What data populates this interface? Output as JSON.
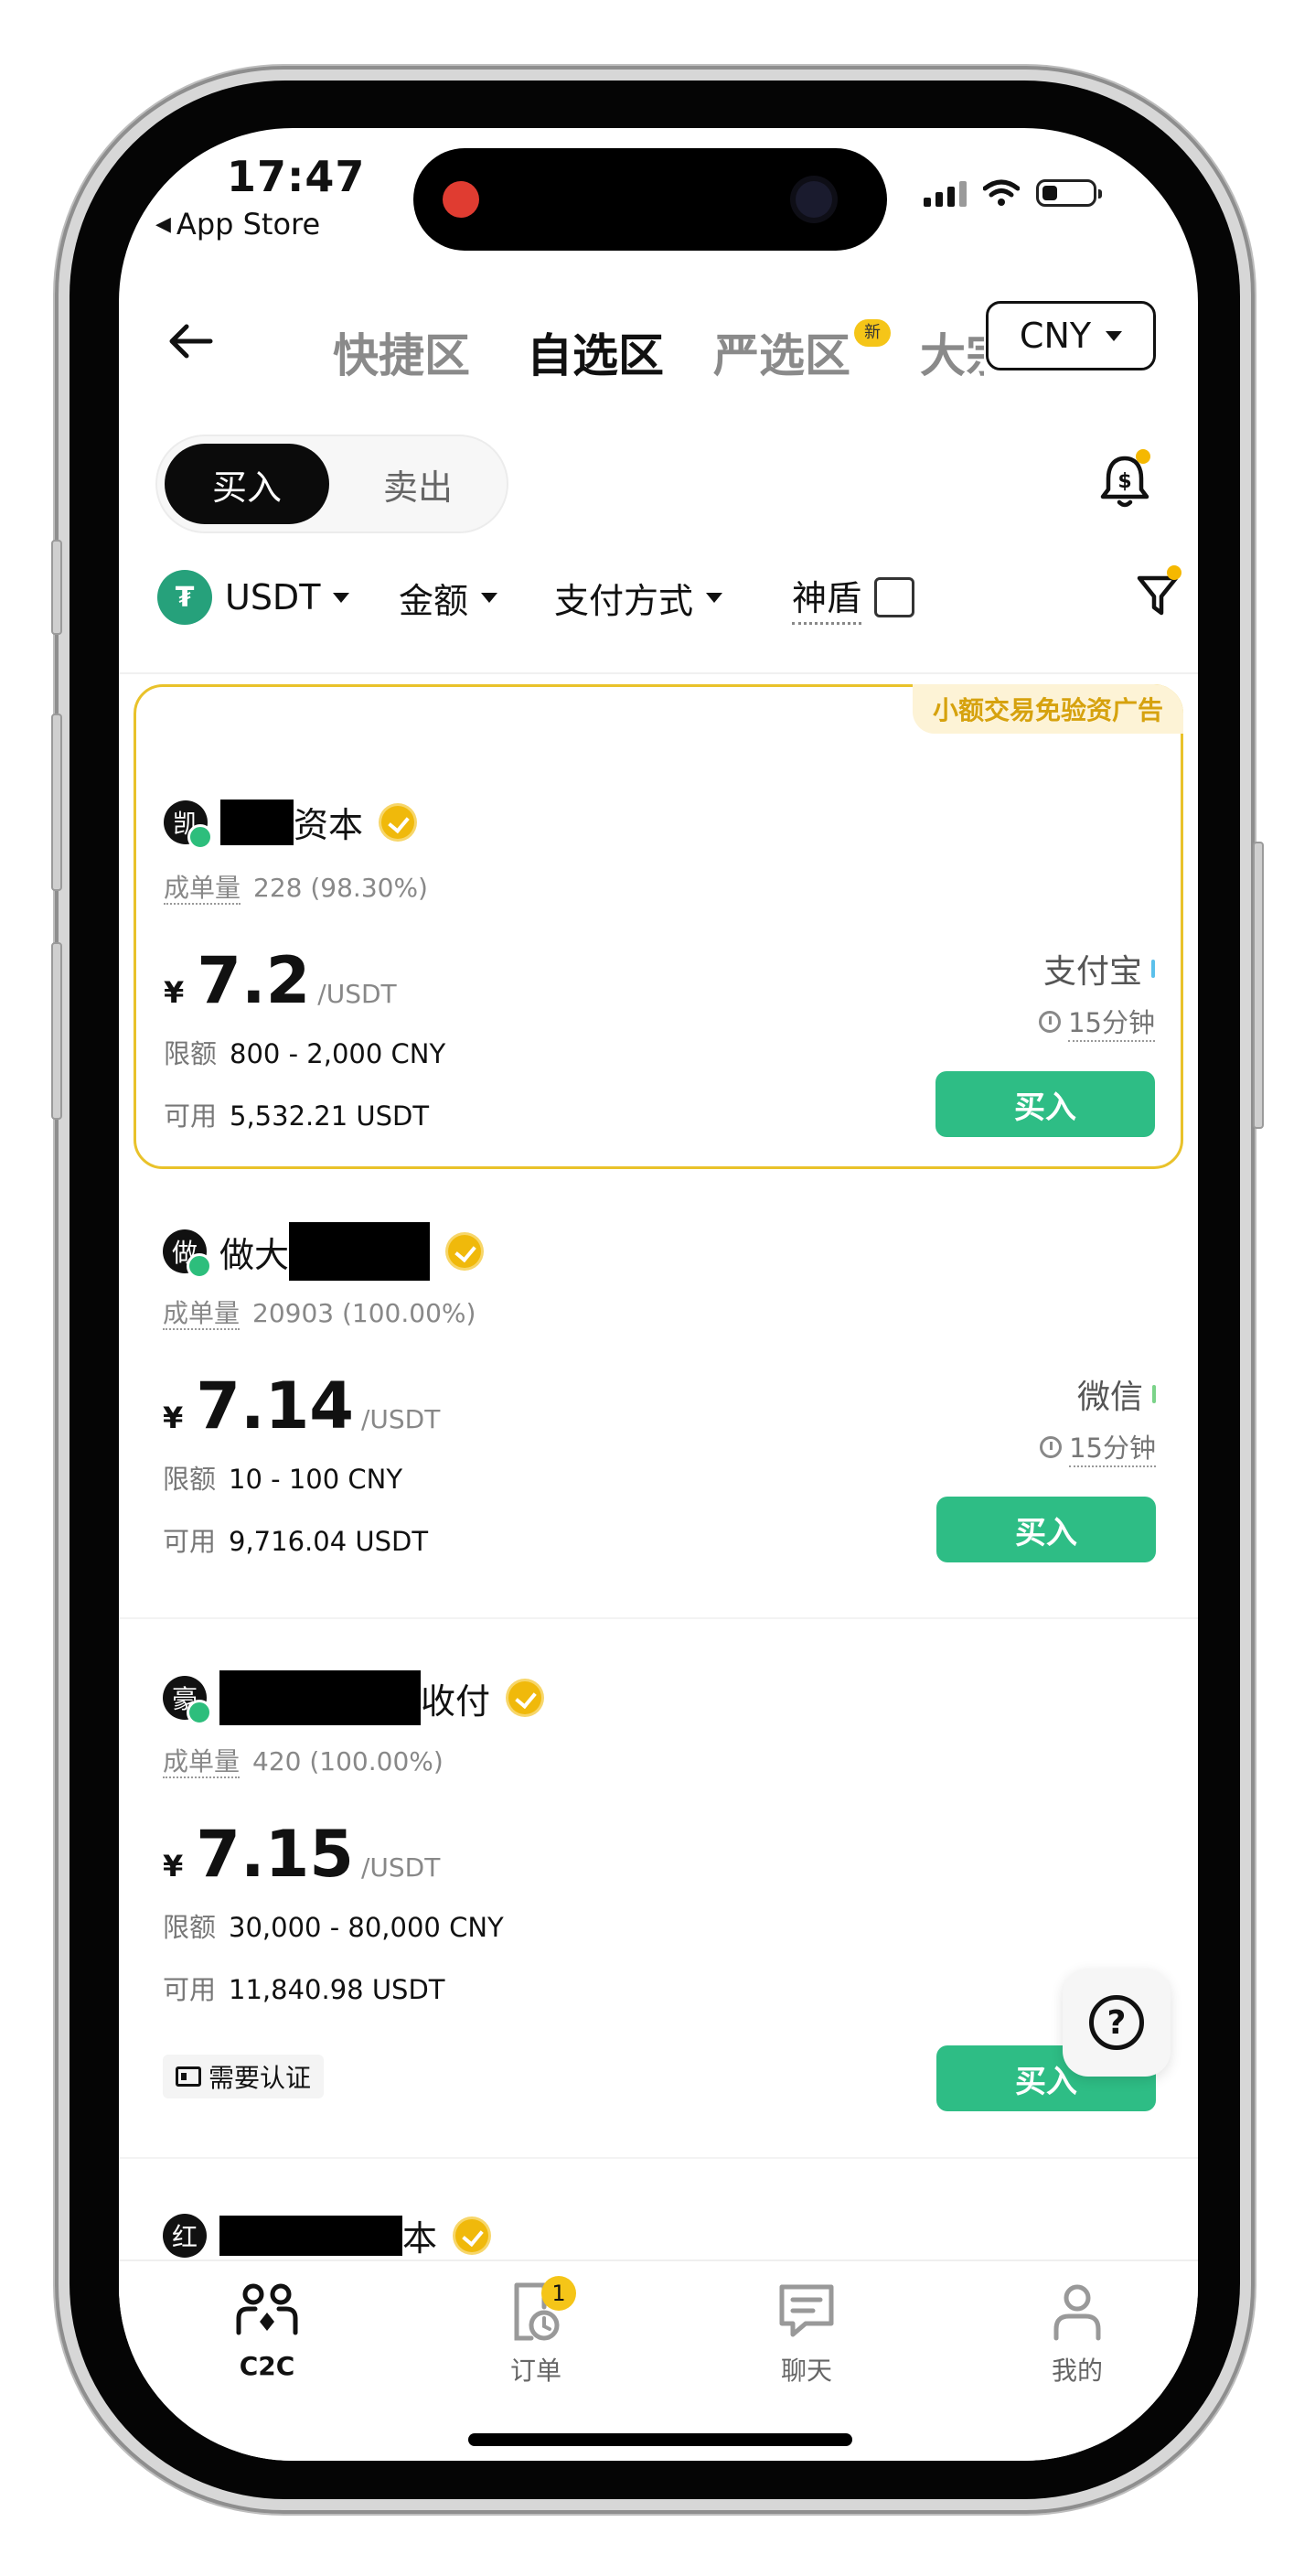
{
  "status_bar": {
    "time": "17:47",
    "back_app": "App Store"
  },
  "header": {
    "tabs": [
      {
        "label": "快捷区",
        "active": false
      },
      {
        "label": "自选区",
        "active": true
      },
      {
        "label": "严选区",
        "active": false,
        "badge": "新"
      },
      {
        "label": "大宗",
        "active": false
      }
    ],
    "currency": "CNY"
  },
  "trade_toggle": {
    "buy": "买入",
    "sell": "卖出",
    "selected": "buy"
  },
  "filters": {
    "asset": "USDT",
    "amount": "金额",
    "payment": "支付方式",
    "shield": "神盾",
    "shield_checked": false
  },
  "ads": [
    {
      "highlighted": true,
      "tag": "小额交易免验资广告",
      "avatar": "凯",
      "name_suffix": "资本",
      "stats_label": "成单量",
      "stats": "228 (98.30%)",
      "currency_symbol": "¥",
      "price": "7.2",
      "unit": "/USDT",
      "limit_label": "限额",
      "limit": "800 - 2,000 CNY",
      "available_label": "可用",
      "available": "5,532.21 USDT",
      "payment": "支付宝",
      "payment_color": "#5bc0eb",
      "duration": "15分钟",
      "button": "买入"
    },
    {
      "highlighted": false,
      "avatar": "做",
      "name_prefix": "做大",
      "stats_label": "成单量",
      "stats": "20903 (100.00%)",
      "currency_symbol": "¥",
      "price": "7.14",
      "unit": "/USDT",
      "limit_label": "限额",
      "limit": "10 - 100 CNY",
      "available_label": "可用",
      "available": "9,716.04 USDT",
      "payment": "微信",
      "payment_color": "#7bd389",
      "duration": "15分钟",
      "button": "买入"
    },
    {
      "highlighted": false,
      "avatar": "豪",
      "name_suffix": "收付",
      "stats_label": "成单量",
      "stats": "420 (100.00%)",
      "currency_symbol": "¥",
      "price": "7.15",
      "unit": "/USDT",
      "limit_label": "限额",
      "limit": "30,000 - 80,000 CNY",
      "available_label": "可用",
      "available": "11,840.98 USDT",
      "kyc": "需要认证",
      "button": "买入"
    },
    {
      "avatar": "红",
      "name_suffix": "本"
    }
  ],
  "bottom_nav": [
    {
      "label": "C2C",
      "icon": "people-icon",
      "active": true
    },
    {
      "label": "订单",
      "icon": "order-clock-icon",
      "active": false,
      "badge": "1"
    },
    {
      "label": "聊天",
      "icon": "chat-icon",
      "active": false
    },
    {
      "label": "我的",
      "icon": "user-icon",
      "active": false
    }
  ],
  "colors": {
    "buy_green": "#2ebd85",
    "highlight_border": "#e9c22a",
    "tag_text": "#d6a20e",
    "badge_yellow": "#f5c518"
  }
}
